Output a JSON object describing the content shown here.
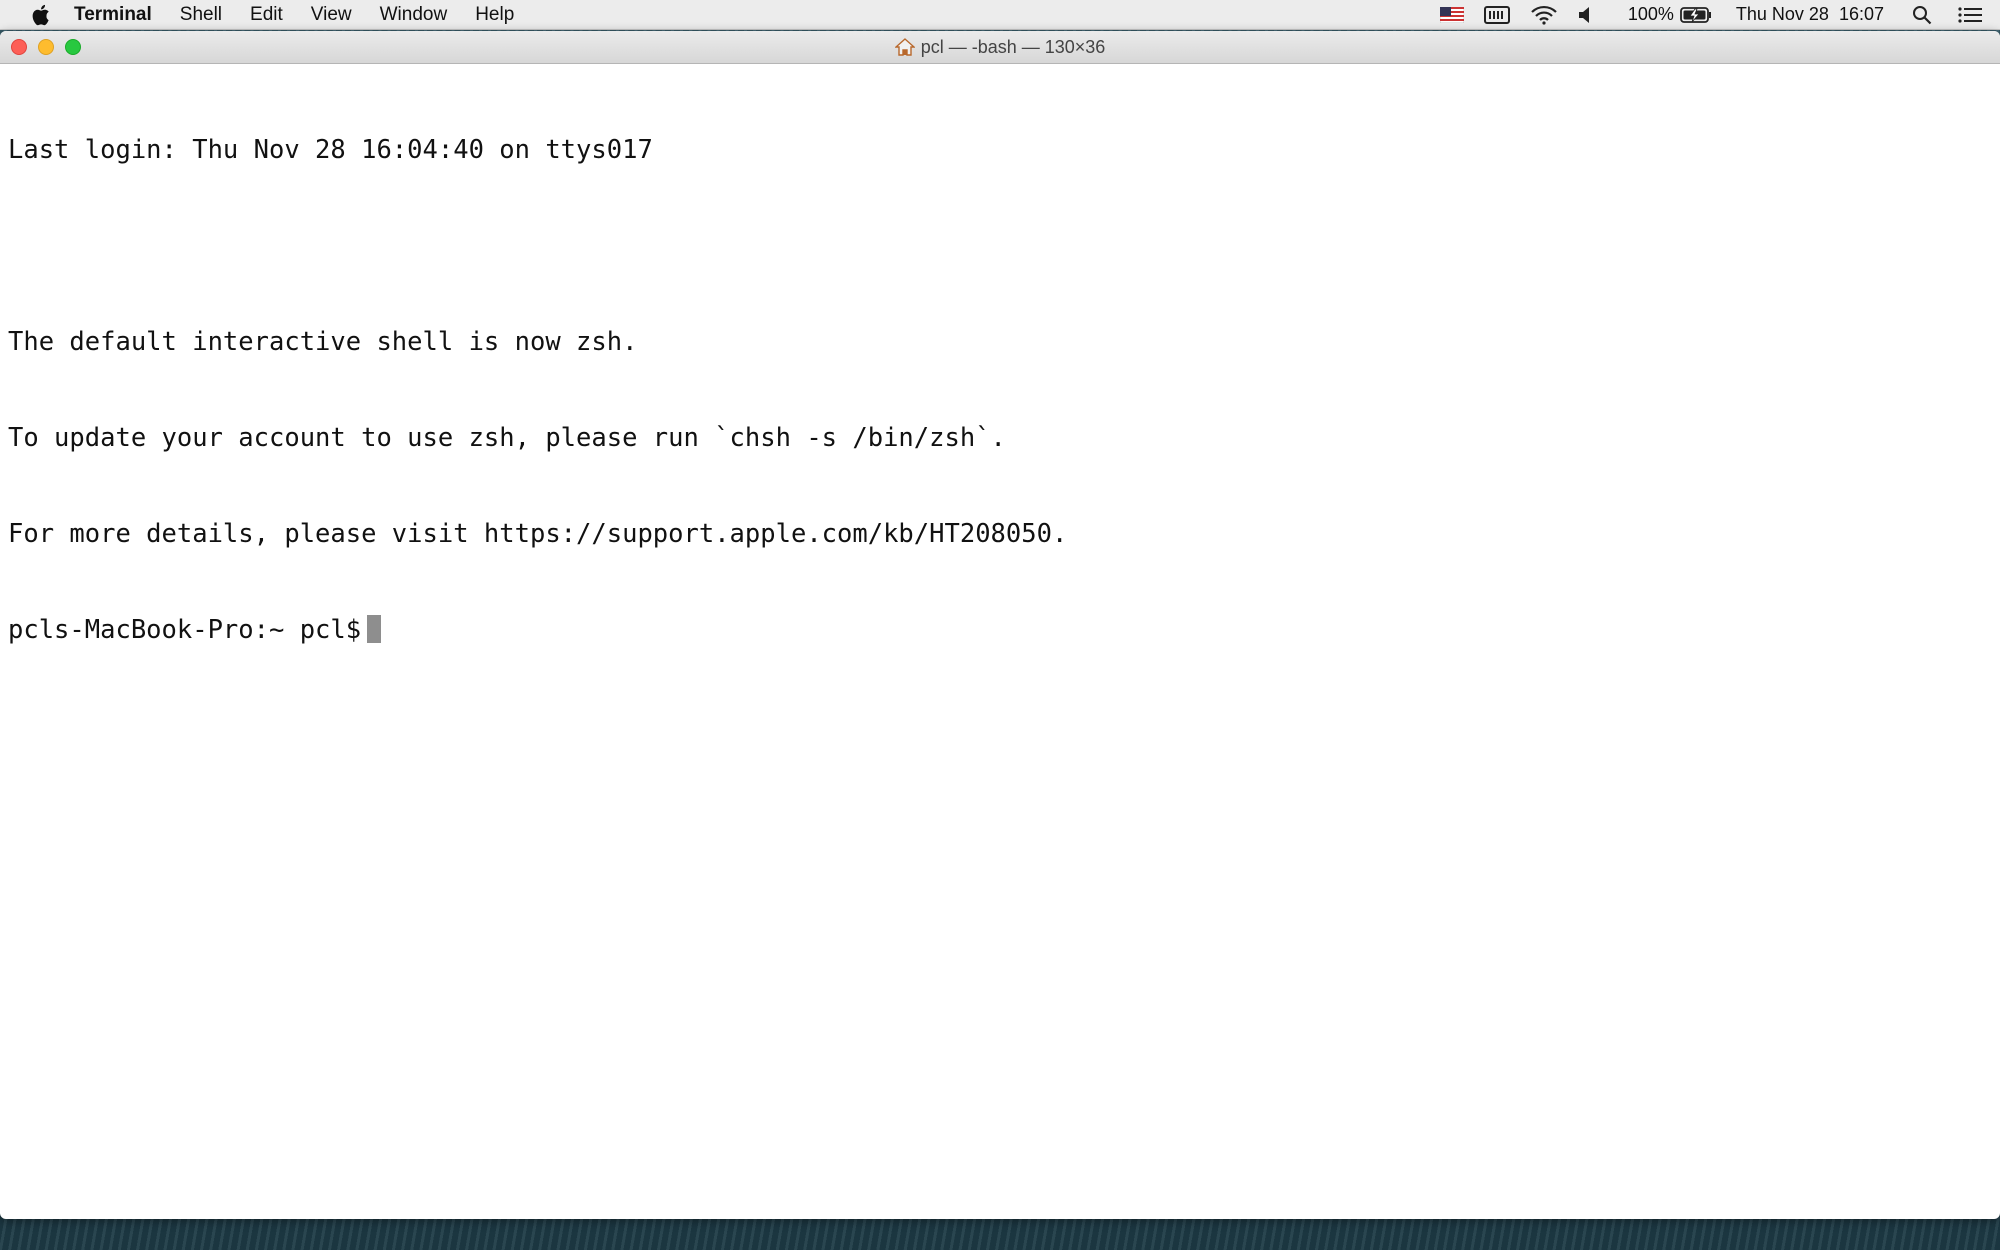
{
  "menubar": {
    "app_name": "Terminal",
    "items": [
      "Shell",
      "Edit",
      "View",
      "Window",
      "Help"
    ],
    "battery": "100%",
    "datetime": "Thu Nov 28  16:07"
  },
  "window": {
    "title": "pcl — -bash — 130×36"
  },
  "terminal": {
    "lines": [
      "Last login: Thu Nov 28 16:04:40 on ttys017",
      "",
      "The default interactive shell is now zsh.",
      "To update your account to use zsh, please run `chsh -s /bin/zsh`.",
      "For more details, please visit https://support.apple.com/kb/HT208050."
    ],
    "prompt": "pcls-MacBook-Pro:~ pcl$"
  },
  "icons": {
    "apple": "apple-icon",
    "flag": "us-flag-icon",
    "keyboard": "keyboard-icon",
    "wifi": "wifi-icon",
    "volume": "volume-icon",
    "battery": "battery-icon",
    "search": "spotlight-search-icon",
    "notifications": "notification-center-icon",
    "home": "home-icon"
  }
}
